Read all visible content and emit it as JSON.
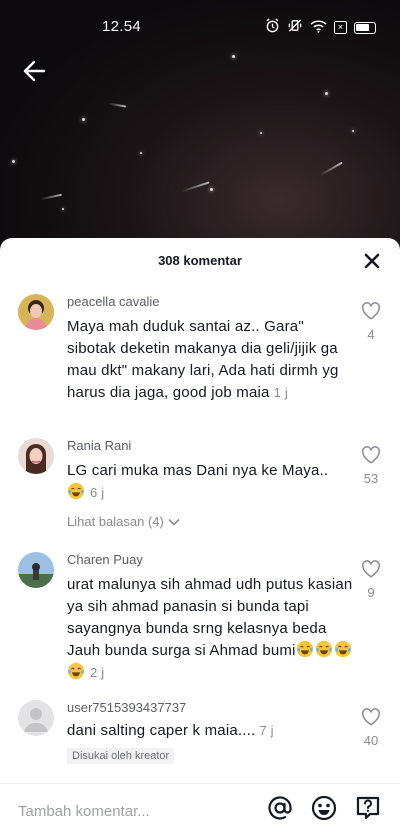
{
  "status_bar": {
    "time": "12.54",
    "alarm_icon": "alarm-icon",
    "mute_icon": "vibrate-off-icon",
    "wifi_icon": "wifi-icon",
    "sim_icon": "no-sim-icon",
    "battery_icon": "battery-icon"
  },
  "header": {
    "back_icon": "arrow-left-icon"
  },
  "sheet": {
    "title": "308 komentar",
    "close_icon": "close-icon"
  },
  "comments": [
    {
      "user": "peacella cavalie",
      "text": "Maya mah duduk santai az.. Gara\" sibotak deketin makanya dia geli/jijik ga mau dkt\" makany lari, Ada hati dirmh yg harus dia jaga, good job maia",
      "time": "1 j",
      "likes": "4"
    },
    {
      "user": "Rania Rani",
      "text": "LG cari muka mas Dani nya ke Maya..",
      "time": "6 j",
      "likes": "53",
      "replies": "Lihat balasan (4)"
    },
    {
      "user": "Charen Puay",
      "text": "urat malunya sih ahmad udh putus kasian ya sih ahmad panasin si bunda tapi sayangnya bunda srng kelasnya beda Jauh bunda surga si Ahmad bumi",
      "time": "2 j",
      "likes": "9"
    },
    {
      "user": "user7515393437737",
      "text": "dani salting caper k maia....",
      "time": "7 j",
      "likes": "40",
      "badge": "Disukai oleh kreator"
    }
  ],
  "input_bar": {
    "placeholder": "Tambah komentar...",
    "icons": [
      "at-mention-icon",
      "emoji-icon",
      "question-icon"
    ]
  }
}
